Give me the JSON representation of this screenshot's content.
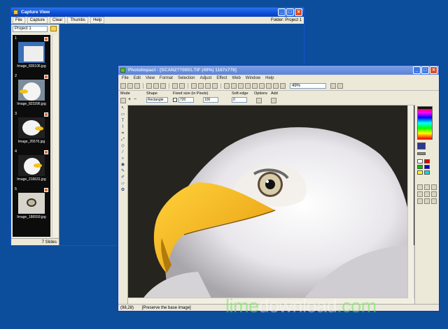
{
  "capture_view": {
    "title": "Capture View",
    "menu": {
      "file": "File",
      "capture": "Capture",
      "clear": "Clear",
      "thumbs": "Thumbs",
      "help": "Help"
    },
    "folder_label": "Folder: Project 1",
    "project_select": "Project 1",
    "thumbnails": [
      {
        "num": "1",
        "caption": "Image_835106.jpg"
      },
      {
        "num": "2",
        "caption": "Image_823396.jpg"
      },
      {
        "num": "3",
        "caption": "Image_26576.jpg"
      },
      {
        "num": "4",
        "caption": "Image_216631.jpg"
      },
      {
        "num": "5",
        "caption": "Image_186559.jpg"
      }
    ],
    "status": "7 Slides"
  },
  "photoimpact": {
    "title": "PhotoImpact - [SCAN2??0001.TIF (49%) 1167x778]",
    "menu": [
      "File",
      "Edit",
      "View",
      "Format",
      "Selection",
      "Adjust",
      "Effect",
      "Web",
      "Window",
      "Help"
    ],
    "zoom": "49%",
    "attr": {
      "mode_label": "Mode",
      "shape_label": "Shape",
      "shape_value": "Rectangle",
      "fixed_size_label": "Fixed size (in Pixels)",
      "width_value": "720",
      "height_value": "100",
      "soft_edge_label": "Soft edge",
      "soft_edge_value": "0",
      "options_label": "Options",
      "add_label": "Add"
    },
    "status_coord": "(98,28)",
    "status_hint": "[Preserve the base image]"
  },
  "watermark": {
    "part1": "lime",
    "part2": "download",
    "part3": ".com"
  },
  "colors": {
    "desktop": "#0d4e9c",
    "titlebar": "#0a4fd6",
    "window": "#ece9d8"
  }
}
